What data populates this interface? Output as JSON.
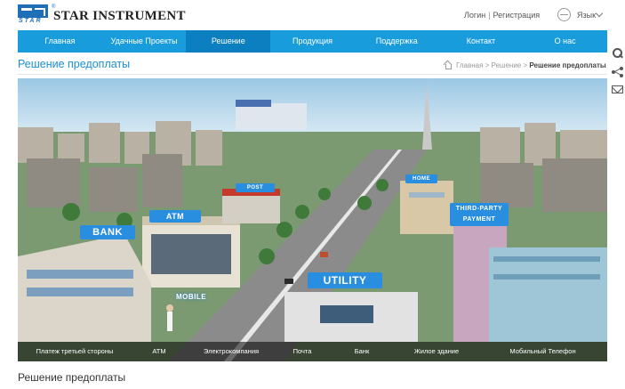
{
  "header": {
    "brand": "STAR INSTRUMENT",
    "logo_text": "STAR",
    "login": "Логин",
    "register": "Регистрация",
    "separator": "|",
    "language": "Язык"
  },
  "nav": {
    "items": [
      "Главная",
      "Удачные Проекты",
      "Решение",
      "Продукция",
      "Поддержка",
      "Контакт",
      "О нас"
    ],
    "active_index": 2
  },
  "page": {
    "title": "Решение предоплаты",
    "breadcrumb": [
      "Главная",
      "Решение",
      "Решение предоплаты"
    ],
    "breadcrumb_sep": ">",
    "section_title": "Решение предоплаты"
  },
  "banner": {
    "labels": {
      "bank": "BANK",
      "atm": "ATM",
      "post": "POST",
      "home": "HOME",
      "utility": "UTILITY",
      "third_party": "THIRD-PARTY PAYMENT",
      "mobile": "MOBILE"
    },
    "tabs": [
      "Платеж третьей стороны",
      "ATM",
      "Электрокомпания",
      "Почта",
      "Банк",
      "Жилое здание",
      "Мобильный Телефон"
    ]
  },
  "icons": [
    "logo-icon",
    "globe-icon",
    "chevron-down-icon",
    "search-icon",
    "share-icon",
    "mail-icon",
    "home-icon"
  ],
  "colors": {
    "nav_bg": "#189cdc",
    "nav_active": "#0c7fc0",
    "title_blue": "#1b8fd2",
    "brand_blue": "#1f6fb8"
  }
}
